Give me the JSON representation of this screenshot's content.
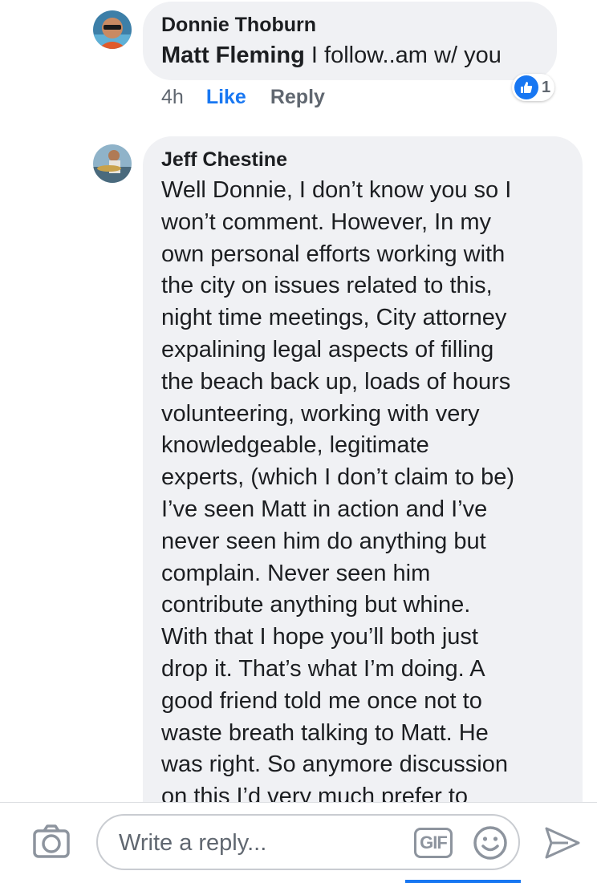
{
  "comments": [
    {
      "author": "Donnie Thoburn",
      "mention": "Matt Fleming",
      "text": " I follow..am w/ you",
      "time": "4h",
      "like_label": "Like",
      "reply_label": "Reply",
      "reaction_count": "1"
    },
    {
      "author": "Jeff Chestine",
      "lines": [
        "Well Donnie, I don’t know you so I",
        "won’t comment. However, In my",
        "own personal efforts working with",
        "the city on issues related to this,",
        "night time meetings, City attorney",
        "expalining legal aspects of filling",
        "the beach back up, loads of hours",
        "volunteering, working with very",
        "knowledgeable, legitimate",
        "experts, (which I don’t claim to be)",
        "I’ve seen Matt in action and I’ve",
        "never seen him do anything but",
        "complain. Never seen him",
        "contribute anything but whine.",
        "With that I hope you’ll both just",
        "drop it. That’s what I’m doing. A",
        "good friend told me once not to",
        "waste breath talking to Matt. He",
        "was right. So anymore discussion",
        "on this I’d very much prefer to"
      ]
    }
  ],
  "composer": {
    "placeholder": "Write a reply...",
    "gif_label": "GIF",
    "icons": [
      "camera-icon",
      "gif-icon",
      "emoji-icon",
      "send-icon"
    ]
  },
  "colors": {
    "accent": "#1877f2",
    "bubble": "#f0f1f4",
    "meta_text": "#606770"
  }
}
